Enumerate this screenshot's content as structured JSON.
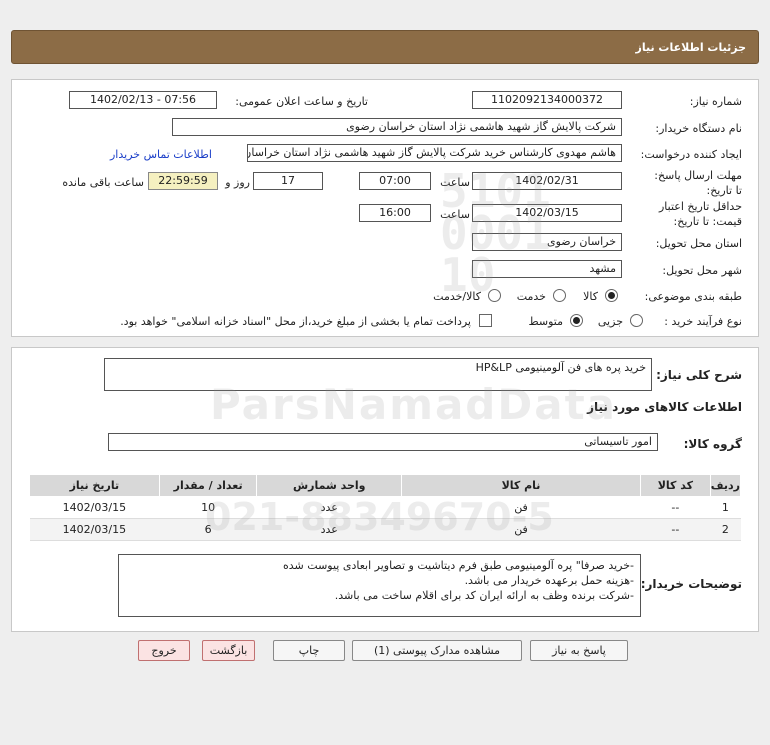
{
  "header": {
    "title": "جزئیات اطلاعات نیاز"
  },
  "form": {
    "need_number_label": "شماره نیاز:",
    "need_number": "1102092134000372",
    "announce_label": "تاریخ و ساعت اعلان عمومی:",
    "announce_value": "1402/02/13 - 07:56",
    "buyer_org_label": "نام دستگاه خریدار:",
    "buyer_org": "شرکت پالایش گاز شهید هاشمی نژاد   استان خراسان رضوی",
    "requester_label": "ایجاد کننده درخواست:",
    "requester": "هاشم مهدوی کارشناس خرید شرکت پالایش گاز شهید هاشمی نژاد   استان خراسان رضوی",
    "contact_link": "اطلاعات تماس خریدار",
    "reply_deadline_label": "مهلت ارسال پاسخ: تا تاریخ:",
    "reply_date": "1402/02/31",
    "time_label": "ساعت",
    "reply_time": "07:00",
    "days_value": "17",
    "days_label": "روز و",
    "remaining_time": "22:59:59",
    "remaining_label": "ساعت باقی مانده",
    "price_validity_label": "حداقل تاریخ اعتبار قیمت: تا تاریخ:",
    "price_date": "1402/03/15",
    "price_time_label": "ساعت",
    "price_time": "16:00",
    "province_label": "استان محل تحویل:",
    "province": "خراسان رضوی",
    "city_label": "شهر محل تحویل:",
    "city": "مشهد",
    "category_label": "طبقه بندی موضوعی:",
    "category_options": [
      "کالا",
      "خدمت",
      "کالا/خدمت"
    ],
    "process_label": "نوع فرآیند خرید :",
    "process_options": [
      "جزیی",
      "متوسط"
    ],
    "payment_note": "پرداخت تمام یا بخشی از مبلغ خرید،از محل \"اسناد خزانه اسلامی\" خواهد بود."
  },
  "summary": {
    "label": "شرح کلی نیاز:",
    "value": "خرید پره های فن آلومینیومی HP&LP"
  },
  "goods": {
    "section_title": "اطلاعات کالاهای مورد نیاز",
    "group_label": "گروه کالا:",
    "group_value": "امور تاسیساتی",
    "columns": [
      "ردیف",
      "کد کالا",
      "نام کالا",
      "واحد شمارش",
      "تعداد / مقدار",
      "تاریخ نیاز"
    ],
    "rows": [
      [
        "1",
        "--",
        "فن",
        "عدد",
        "10",
        "1402/03/15"
      ],
      [
        "2",
        "--",
        "فن",
        "عدد",
        "6",
        "1402/03/15"
      ]
    ]
  },
  "buyer_notes": {
    "label": "توضیحات خریدار:",
    "lines": [
      "-خرید صرفا\" پره آلومینیومی طبق فرم دیتاشیت و تصاویر ابعادی پیوست شده",
      "-هزینه حمل برعهده خریدار می باشد.",
      "-شرکت برنده وظف به ارائه ایران کد برای اقلام ساخت می باشد."
    ]
  },
  "buttons": {
    "reply": "پاسخ به نیاز",
    "attachments": "مشاهده مدارک پیوستی (1)",
    "print": "چاپ",
    "back": "بازگشت",
    "exit": "خروج"
  }
}
